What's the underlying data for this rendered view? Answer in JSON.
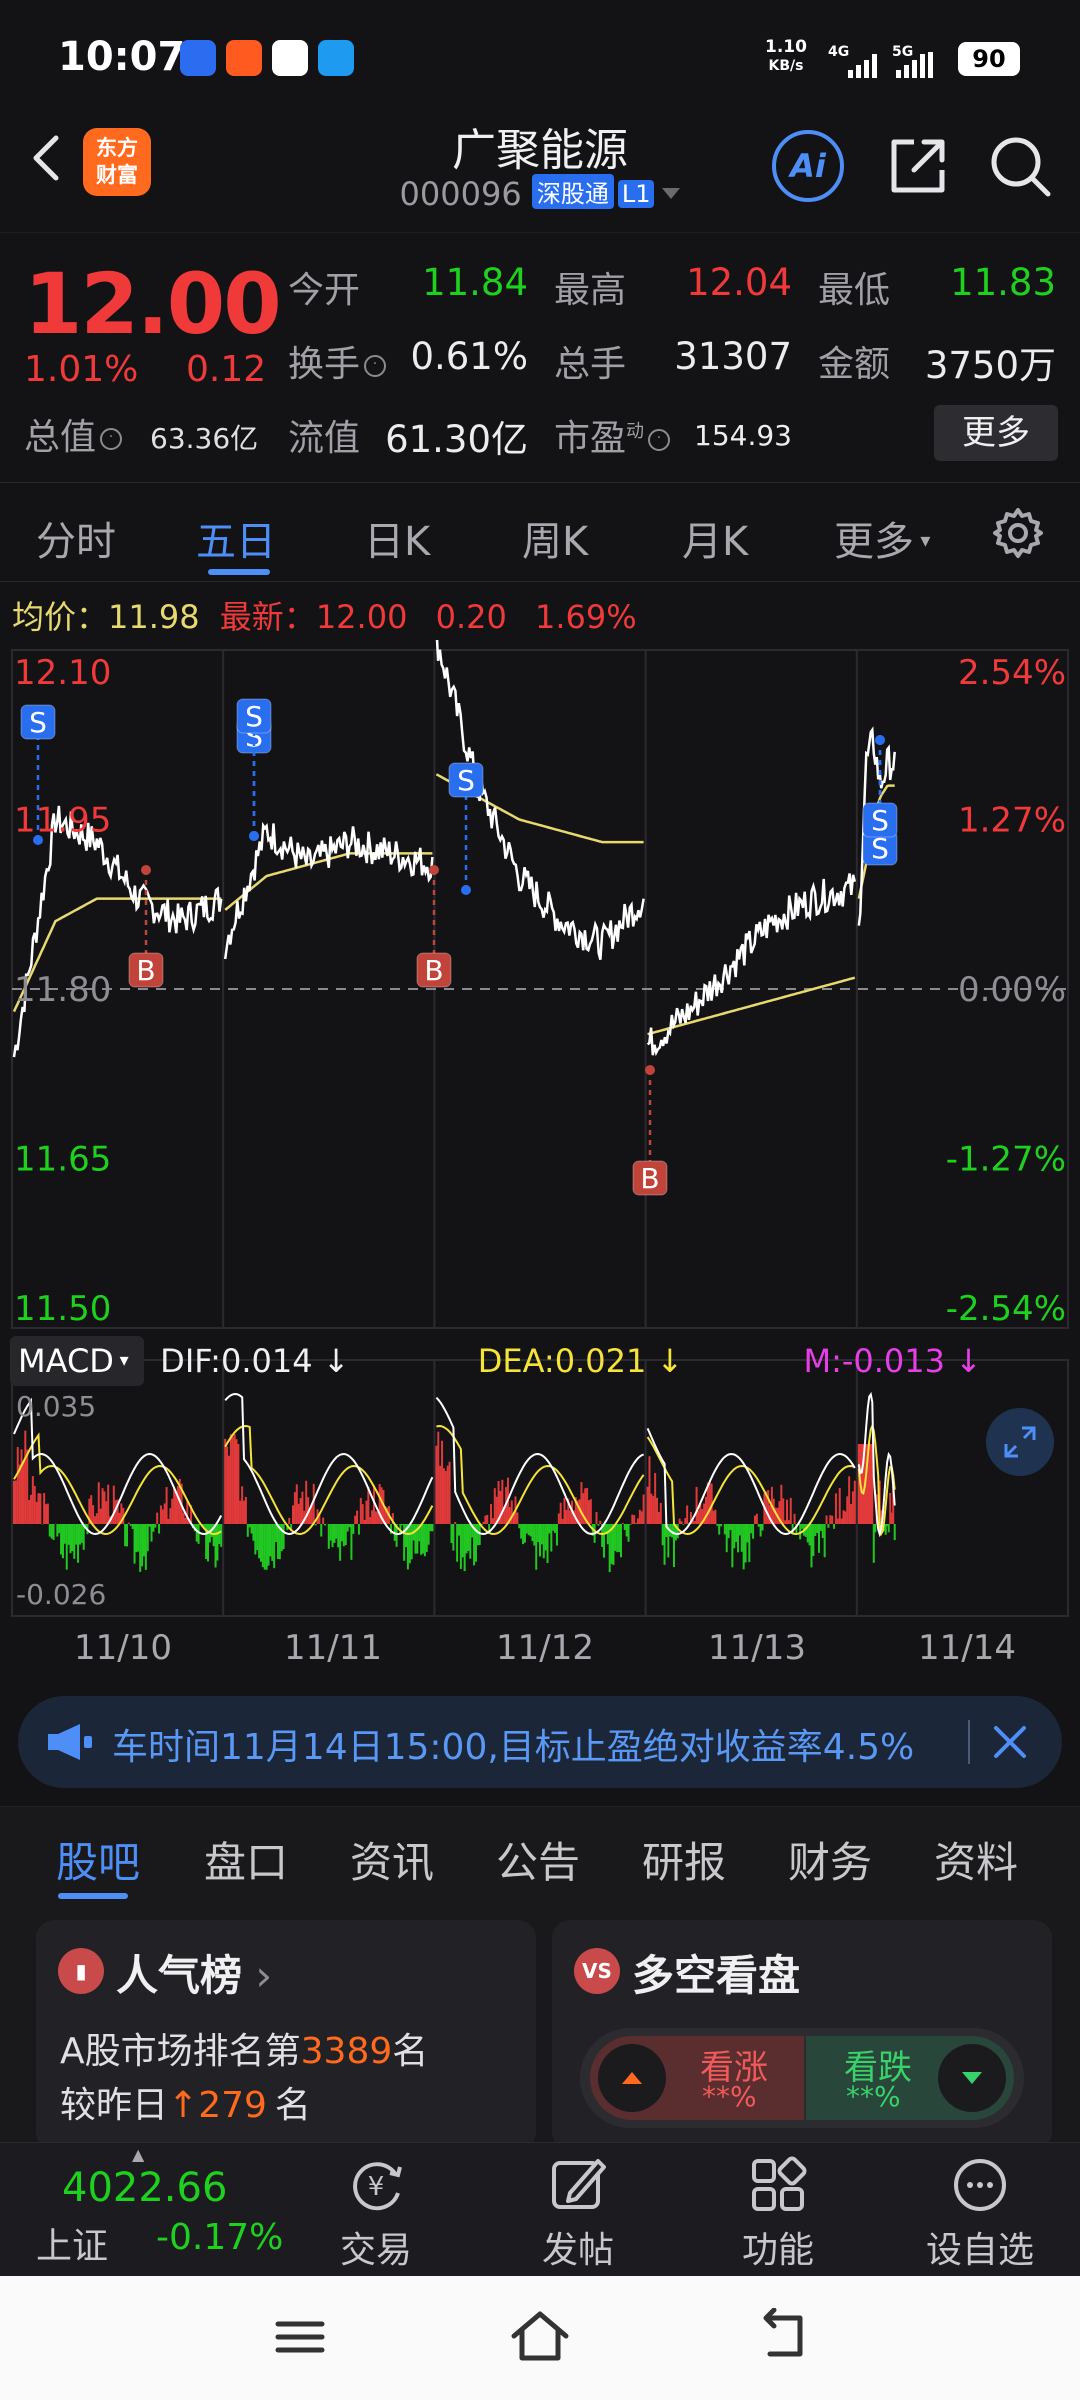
{
  "status_bar": {
    "time": "10:07",
    "net_speed": "1.10",
    "net_unit": "KB/s",
    "sig1": "4G",
    "sig2": "5G",
    "battery": "90"
  },
  "header": {
    "logo_line1": "东方",
    "logo_line2": "财富",
    "stock_name": "广聚能源",
    "stock_code": "000096",
    "exchange_tag": "深股通",
    "level_tag": "L1",
    "ai_label": "Ai"
  },
  "quote": {
    "price": "12.00",
    "change_pct": "1.01%",
    "change_amt": "0.12",
    "total_value_label": "总值",
    "total_value": "63.36亿",
    "open_label": "今开",
    "open": "11.84",
    "high_label": "最高",
    "high": "12.04",
    "low_label": "最低",
    "low": "11.83",
    "turnover_label": "换手",
    "turnover": "0.61%",
    "volume_label": "总手",
    "volume": "31307",
    "amount_label": "金额",
    "amount": "3750万",
    "float_label": "流值",
    "float_value": "61.30亿",
    "pe_label": "市盈",
    "pe_sup": "动",
    "pe": "154.93",
    "more_label": "更多"
  },
  "chart_tabs": [
    "分时",
    "五日",
    "日K",
    "周K",
    "月K",
    "更多"
  ],
  "chart_tab_active": "五日",
  "chart_legend": {
    "avg_label": "均价：",
    "avg": "11.98",
    "latest_label": "最新：",
    "latest": "12.00",
    "change": "0.20",
    "change_pct": "1.69%"
  },
  "chart_data": {
    "type": "line",
    "title": "",
    "y_ticks_left": [
      "12.10",
      "11.95",
      "11.80",
      "11.65",
      "11.50"
    ],
    "y_ticks_right": [
      "2.54%",
      "1.27%",
      "0.00%",
      "-1.27%",
      "-2.54%"
    ],
    "ylim": [
      11.5,
      12.1
    ],
    "reference_price": 11.8,
    "x_labels": [
      "11/10",
      "11/11",
      "11/12",
      "11/13",
      "11/14"
    ],
    "series": [
      {
        "name": "最新",
        "color": "#ffffff"
      },
      {
        "name": "均价",
        "color": "#e8d870"
      }
    ],
    "trade_markers": [
      {
        "type": "S",
        "day": "11/10"
      },
      {
        "type": "B",
        "day": "11/10"
      },
      {
        "type": "S",
        "day": "11/11"
      },
      {
        "type": "S",
        "day": "11/11"
      },
      {
        "type": "B",
        "day": "11/12"
      },
      {
        "type": "S",
        "day": "11/12"
      },
      {
        "type": "B",
        "day": "11/13"
      },
      {
        "type": "S",
        "day": "11/14"
      },
      {
        "type": "S",
        "day": "11/14"
      }
    ]
  },
  "macd": {
    "name": "MACD",
    "dif": "DIF:0.014 ↓",
    "dea": "DEA:0.021 ↓",
    "m": "M:-0.013 ↓",
    "top": "0.035",
    "bottom": "-0.026"
  },
  "banner": {
    "text": "车时间11月14日15:00,目标止盈绝对收益率4.5%"
  },
  "sub_tabs": [
    "股吧",
    "盘口",
    "资讯",
    "公告",
    "研报",
    "财务",
    "资料"
  ],
  "sub_tab_active": "股吧",
  "popularity": {
    "title": "人气榜",
    "line1_prefix": "A股市场排名第",
    "rank": "3389",
    "line1_suffix": "名",
    "line2_prefix": "较昨日",
    "delta": "279",
    "line2_suffix": "名"
  },
  "sentiment": {
    "title": "多空看盘",
    "icon": "VS",
    "up_label": "看涨",
    "up_value": "**%",
    "down_label": "看跌",
    "down_value": "**%"
  },
  "bottom_nav": {
    "index_value": "4022.66",
    "index_name": "上证",
    "index_change": "-0.17%",
    "items": [
      "交易",
      "发帖",
      "功能",
      "设自选"
    ]
  }
}
